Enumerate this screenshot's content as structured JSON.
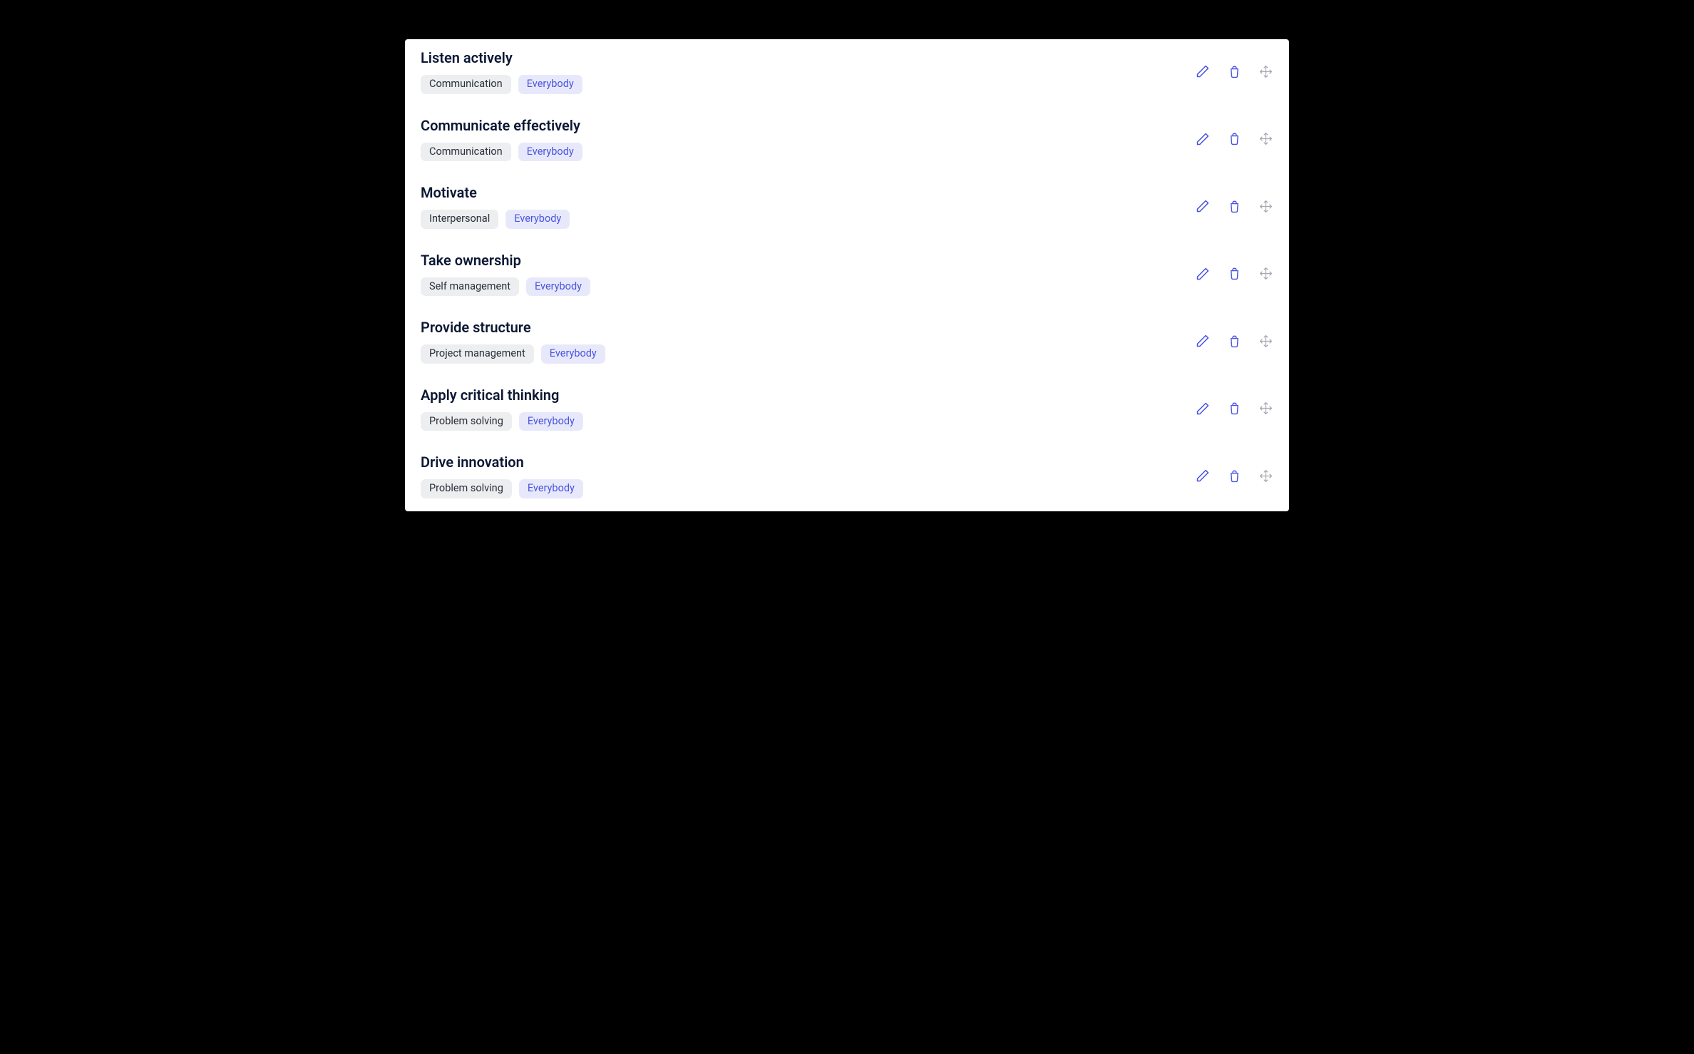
{
  "items": [
    {
      "title": "Listen actively",
      "category": "Communication",
      "audience": "Everybody"
    },
    {
      "title": "Communicate effectively",
      "category": "Communication",
      "audience": "Everybody"
    },
    {
      "title": "Motivate",
      "category": "Interpersonal",
      "audience": "Everybody"
    },
    {
      "title": "Take ownership",
      "category": "Self management",
      "audience": "Everybody"
    },
    {
      "title": "Provide structure",
      "category": "Project management",
      "audience": "Everybody"
    },
    {
      "title": "Apply critical thinking",
      "category": "Problem solving",
      "audience": "Everybody"
    },
    {
      "title": "Drive innovation",
      "category": "Problem solving",
      "audience": "Everybody"
    }
  ]
}
